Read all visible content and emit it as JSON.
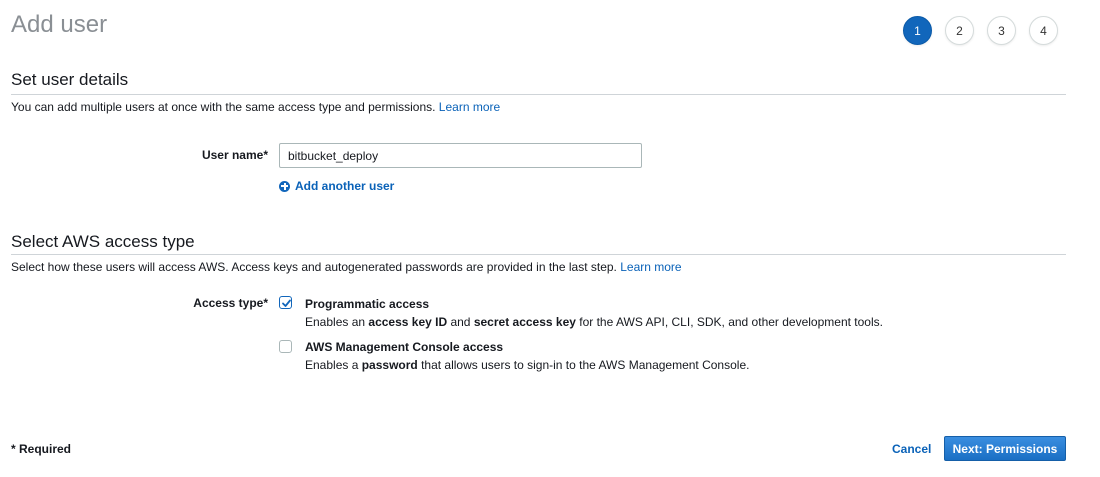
{
  "page": {
    "title": "Add user"
  },
  "steps": [
    {
      "label": "1",
      "active": true
    },
    {
      "label": "2",
      "active": false
    },
    {
      "label": "3",
      "active": false
    },
    {
      "label": "4",
      "active": false
    }
  ],
  "details": {
    "title": "Set user details",
    "description": "You can add multiple users at once with the same access type and permissions.",
    "learn_more": "Learn more",
    "user_name_label": "User name*",
    "user_name_value": "bitbucket_deploy",
    "add_another": "Add another user"
  },
  "access": {
    "title": "Select AWS access type",
    "description": "Select how these users will access AWS. Access keys and autogenerated passwords are provided in the last step.",
    "learn_more": "Learn more",
    "label": "Access type*",
    "programmatic": {
      "title": "Programmatic access",
      "checked": true,
      "desc_1": "Enables an ",
      "desc_b1": "access key ID",
      "desc_2": " and ",
      "desc_b2": "secret access key",
      "desc_3": " for the AWS API, CLI, SDK, and other development tools."
    },
    "console": {
      "title": "AWS Management Console access",
      "checked": false,
      "desc_1": "Enables a ",
      "desc_b1": "password",
      "desc_2": " that allows users to sign-in to the AWS Management Console."
    }
  },
  "footer": {
    "required": "* Required",
    "cancel": "Cancel",
    "next": "Next: Permissions"
  },
  "colors": {
    "accent": "#1166bb",
    "link": "#0a62b8",
    "title_gray": "#8a8f94"
  }
}
